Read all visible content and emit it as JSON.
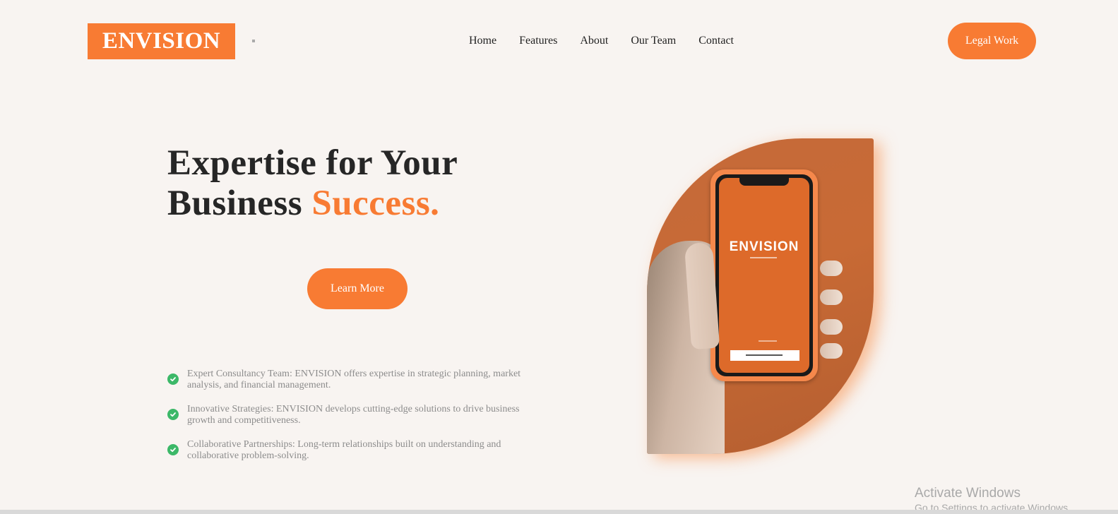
{
  "brand": {
    "logo_text": "ENVISION"
  },
  "nav": {
    "items": [
      {
        "label": "Home"
      },
      {
        "label": "Features"
      },
      {
        "label": "About"
      },
      {
        "label": "Our Team"
      },
      {
        "label": "Contact"
      }
    ]
  },
  "header": {
    "cta_label": "Legal Work"
  },
  "hero": {
    "title_line1": "Expertise for Your",
    "title_line2_plain": "Business ",
    "title_line2_accent": "Success.",
    "button_label": "Learn More",
    "phone_brand": "ENVISION"
  },
  "features": [
    {
      "text": "Expert Consultancy Team: ENVISION offers expertise in strategic planning, market analysis, and financial management."
    },
    {
      "text": "Innovative Strategies: ENVISION develops cutting-edge solutions to drive business growth and competitiveness."
    },
    {
      "text": "Collaborative Partnerships: Long-term relationships built on understanding and collaborative problem-solving."
    }
  ],
  "os_watermark": {
    "title": "Activate Windows",
    "subtitle": "Go to Settings to activate Windows."
  },
  "colors": {
    "accent": "#f87b33",
    "background": "#f8f4f1",
    "check": "#3cb868"
  },
  "icons": {
    "feature_bullet": "check-circle-icon"
  }
}
